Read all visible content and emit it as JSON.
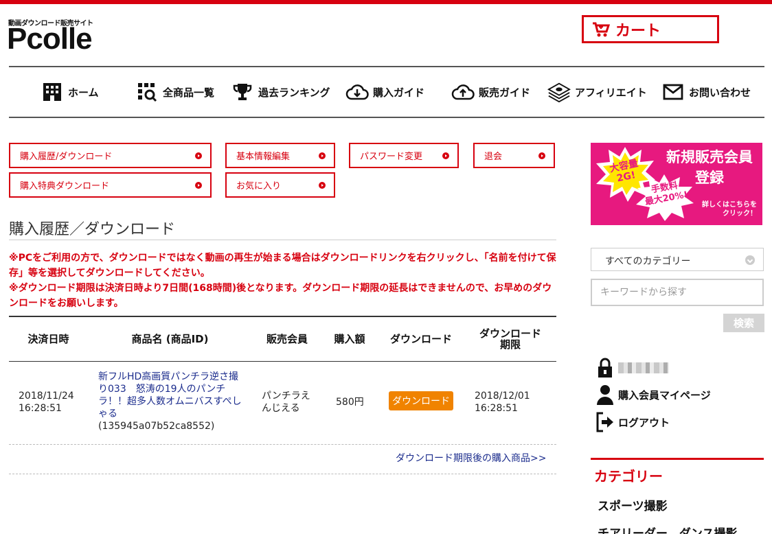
{
  "header": {
    "logo_sub": "動画ダウンロード販売サイト",
    "logo": "Pcolle",
    "cart_label": "カート"
  },
  "nav": [
    {
      "label": "ホーム",
      "icon": "building-icon"
    },
    {
      "label": "全商品一覧",
      "icon": "grid-search-icon"
    },
    {
      "label": "過去ランキング",
      "icon": "trophy-icon"
    },
    {
      "label": "購入ガイド",
      "icon": "cloud-download-icon"
    },
    {
      "label": "販売ガイド",
      "icon": "cloud-upload-icon"
    },
    {
      "label": "アフィリエイト",
      "icon": "money-stack-icon"
    },
    {
      "label": "お問い合わせ",
      "icon": "envelope-icon"
    }
  ],
  "account_menu": [
    "購入履歴/ダウンロード",
    "基本情報編集",
    "パスワード変更",
    "退会",
    "購入特典ダウンロード",
    "お気に入り"
  ],
  "main": {
    "title": "購入履歴／ダウンロード",
    "notice1": "※PCをご利用の方で、ダウンロードではなく動画の再生が始まる場合はダウンロードリンクを右クリックし、「名前を付けて保存」等を選択してダウンロードしてください。",
    "notice2": "※ダウンロード期限は決済日時より7日間(168時間)後となります。ダウンロード期限の延長はできませんので、お早めのダウンロードをお願いします。"
  },
  "table": {
    "headers": [
      "決済日時",
      "商品名 (商品ID)",
      "販売会員",
      "購入額",
      "ダウンロード",
      "ダウンロード\n期限"
    ],
    "rows": [
      {
        "date": "2018/11/24\n16:28:51",
        "product": "新フルHD高画質パンチラ逆さ撮り033　怒涛の19人のパンチラ！！超多人数オムニバスすぺしゃる",
        "product_id": "(135945a07b52ca8552)",
        "seller": "パンチラえんじえる",
        "price": "580円",
        "download_label": "ダウンロード",
        "expiry": "2018/12/01\n16:28:51"
      }
    ],
    "after_link": "ダウンロード期限後の購入商品>>"
  },
  "sidebar": {
    "banner": {
      "title": "新規販売会員\n登録",
      "burst1": "大容量\n2G!",
      "burst2": "手数料\n最大20%!",
      "sub": "詳しくはこちらを\nクリック！",
      "color": "#e7197f"
    },
    "category_select": "すべてのカテゴリー",
    "keyword_placeholder": "キーワードから探す",
    "search_label": "検索",
    "mypage_label": "購入会員マイページ",
    "logout_label": "ログアウト",
    "category_title": "カテゴリー",
    "categories": [
      "スポーツ撮影",
      "チアリーダー、ダンス撮影"
    ]
  },
  "colors": {
    "brand_red": "#d7000f",
    "download_orange": "#f08300",
    "link_blue": "#1a2b8c"
  }
}
